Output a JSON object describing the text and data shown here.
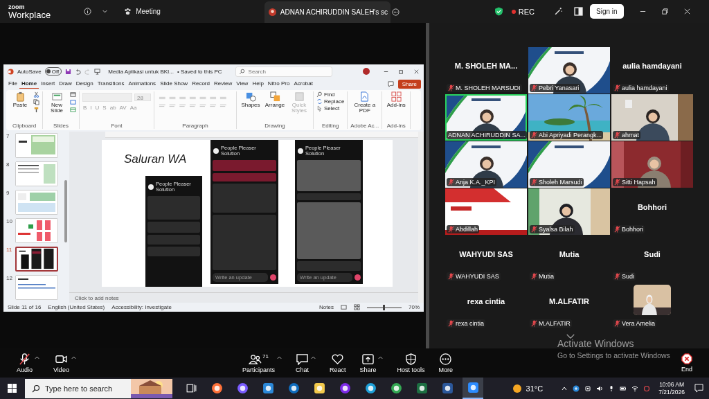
{
  "top_bar": {
    "brand_top": "zoom",
    "brand": "Workplace",
    "meeting": "Meeting",
    "share_tab": "ADNAN ACHIRUDDIN SALEH's sc",
    "recording": true,
    "rec_label": "REC",
    "sign_in": "Sign in"
  },
  "powerpoint": {
    "autosave": {
      "label": "AutoSave",
      "on": false,
      "state": "Off"
    },
    "document": "Media Aplikasi untuk BKI...",
    "save_status": "• Saved to this PC",
    "search": {
      "placeholder": "Search"
    },
    "share": "Share",
    "tabs": [
      {
        "label": "File",
        "selected": false
      },
      {
        "label": "Home",
        "selected": true
      },
      {
        "label": "Insert",
        "selected": false
      },
      {
        "label": "Draw",
        "selected": false
      },
      {
        "label": "Design",
        "selected": false
      },
      {
        "label": "Transitions",
        "selected": false
      },
      {
        "label": "Animations",
        "selected": false
      },
      {
        "label": "Slide Show",
        "selected": false
      },
      {
        "label": "Record",
        "selected": false
      },
      {
        "label": "Review",
        "selected": false
      },
      {
        "label": "View",
        "selected": false
      },
      {
        "label": "Help",
        "selected": false
      },
      {
        "label": "Nitro Pro",
        "selected": false
      },
      {
        "label": "Acrobat",
        "selected": false
      }
    ],
    "ribbon": [
      {
        "label": "Clipboard",
        "kind": "large",
        "buttons": [
          {
            "label": "Paste",
            "disabled": false
          }
        ]
      },
      {
        "label": "Slides",
        "kind": "large",
        "buttons": [
          {
            "label": "New Slide",
            "disabled": false
          }
        ]
      },
      {
        "label": "Font",
        "kind": "font",
        "font_size": "28",
        "format_buttons": [
          "B",
          "I",
          "U",
          "S",
          "ab",
          "AV",
          "Aa"
        ]
      },
      {
        "label": "Paragraph",
        "kind": "paragraph"
      },
      {
        "label": "Drawing",
        "kind": "large",
        "buttons": [
          {
            "label": "Shapes",
            "disabled": false
          },
          {
            "label": "Arrange",
            "disabled": false
          },
          {
            "label": "Quick Styles",
            "disabled": true
          }
        ]
      },
      {
        "label": "Editing",
        "kind": "small",
        "buttons": [
          {
            "label": "Find",
            "disabled": false
          },
          {
            "label": "Replace",
            "disabled": false
          },
          {
            "label": "Select",
            "disabled": false
          }
        ]
      },
      {
        "label": "Adobe Ac...",
        "kind": "large",
        "buttons": [
          {
            "label": "Create a PDF",
            "disabled": false
          }
        ]
      },
      {
        "label": "Add-ins",
        "kind": "large",
        "buttons": [
          {
            "label": "Add-ins",
            "disabled": false
          }
        ]
      }
    ],
    "slides": [
      {
        "number": "7",
        "selected": false,
        "kind": "infographic"
      },
      {
        "number": "8",
        "selected": false,
        "kind": "text"
      },
      {
        "number": "9",
        "selected": false,
        "kind": "table"
      },
      {
        "number": "10",
        "selected": false,
        "kind": "pink"
      },
      {
        "number": "11",
        "selected": true,
        "kind": "phones"
      },
      {
        "number": "12",
        "selected": false,
        "kind": "document"
      }
    ],
    "slide": {
      "title": "Saluran WA",
      "phones": [
        {
          "kind": "profile",
          "channel": "People Pleaser Solution"
        },
        {
          "kind": "chat",
          "channel": "People Pleaser Solution",
          "placeholder": "Write an update"
        },
        {
          "kind": "media",
          "channel": "People Pleaser Solution",
          "placeholder": "Write an update"
        }
      ]
    },
    "notes_placeholder": "Click to add notes",
    "status_bar": {
      "slide_position": "Slide 11 of 16",
      "language": "English (United States)",
      "accessibility": "Accessibility: Investigate",
      "notes": "Notes",
      "zoom": "70%",
      "zoom_slider": {
        "level": 0.5
      }
    }
  },
  "gallery": {
    "tiles": [
      {
        "kind": "name",
        "title": "M. SHOLEH MA...",
        "name": "M. SHOLEH MARSUDI",
        "muted": true,
        "speaking": false
      },
      {
        "kind": "video",
        "name": "Pebri Yanasari",
        "muted": true,
        "speaking": false
      },
      {
        "kind": "name",
        "title": "aulia hamdayani",
        "name": "aulia hamdayani",
        "muted": true,
        "speaking": false
      },
      {
        "kind": "video",
        "name": "ADNAN ACHIRUDDIN SA...",
        "muted": false,
        "speaking": true
      },
      {
        "kind": "video",
        "name": "Abi Apriyadi Perangk...",
        "muted": true,
        "speaking": false
      },
      {
        "kind": "video",
        "name": "ahmat",
        "muted": true,
        "speaking": false
      },
      {
        "kind": "video",
        "name": "Anja K.A._KPI",
        "muted": true,
        "speaking": false
      },
      {
        "kind": "video",
        "name": "Sholeh Marsudi",
        "muted": true,
        "speaking": false
      },
      {
        "kind": "video",
        "name": "Sitti Hapsah",
        "muted": true,
        "speaking": false
      },
      {
        "kind": "video",
        "name": "Abdillah",
        "muted": true,
        "speaking": false
      },
      {
        "kind": "video",
        "name": "Syalsa Bilah",
        "muted": true,
        "speaking": false
      },
      {
        "kind": "name",
        "title": "Bohhori",
        "name": "Bohhori",
        "muted": true,
        "speaking": false
      },
      {
        "kind": "name",
        "title": "WAHYUDI SAS",
        "name": "WAHYUDI SAS",
        "muted": true,
        "speaking": false
      },
      {
        "kind": "name",
        "title": "Mutia",
        "name": "Mutia",
        "muted": true,
        "speaking": false
      },
      {
        "kind": "name",
        "title": "Sudi",
        "name": "Sudi",
        "muted": true,
        "speaking": false
      },
      {
        "kind": "name",
        "title": "rexa cintia",
        "name": "rexa cintia",
        "muted": true,
        "speaking": false
      },
      {
        "kind": "name",
        "title": "M.ALFATIR",
        "name": "M.ALFATIR",
        "muted": true,
        "speaking": false
      },
      {
        "kind": "avatar",
        "name": "Vera Amelia",
        "muted": true,
        "speaking": false
      }
    ]
  },
  "toolbar": {
    "items": [
      {
        "kind": "audio",
        "label": "Audio",
        "muted": true,
        "menu": true
      },
      {
        "kind": "video",
        "label": "Video",
        "muted": false,
        "menu": true
      },
      {
        "kind": "participants",
        "label": "Participants",
        "count": "71",
        "menu": true
      },
      {
        "kind": "chat",
        "label": "Chat",
        "menu": true
      },
      {
        "kind": "react",
        "label": "React",
        "menu": false
      },
      {
        "kind": "share",
        "label": "Share",
        "menu": true
      },
      {
        "kind": "host",
        "label": "Host tools",
        "menu": false
      },
      {
        "kind": "more",
        "label": "More",
        "menu": false
      }
    ],
    "end": "End"
  },
  "activation": {
    "title": "Activate Windows",
    "message": "Go to Settings to activate Windows"
  },
  "taskbar": {
    "search_placeholder": "Type here to search",
    "apps": [
      {
        "kind": "taskview",
        "active": false
      },
      {
        "kind": "firefox",
        "active": false
      },
      {
        "kind": "copilot",
        "active": false
      },
      {
        "kind": "store",
        "active": false
      },
      {
        "kind": "outlook",
        "active": false
      },
      {
        "kind": "explorer",
        "active": false
      },
      {
        "kind": "canva",
        "active": false
      },
      {
        "kind": "edge",
        "active": false
      },
      {
        "kind": "chrome",
        "active": false
      },
      {
        "kind": "excel",
        "active": false
      },
      {
        "kind": "word",
        "active": false
      },
      {
        "kind": "zoom",
        "active": true
      }
    ],
    "weather": "31°C",
    "time": "10:06 AM",
    "date": "7/21/2026"
  }
}
